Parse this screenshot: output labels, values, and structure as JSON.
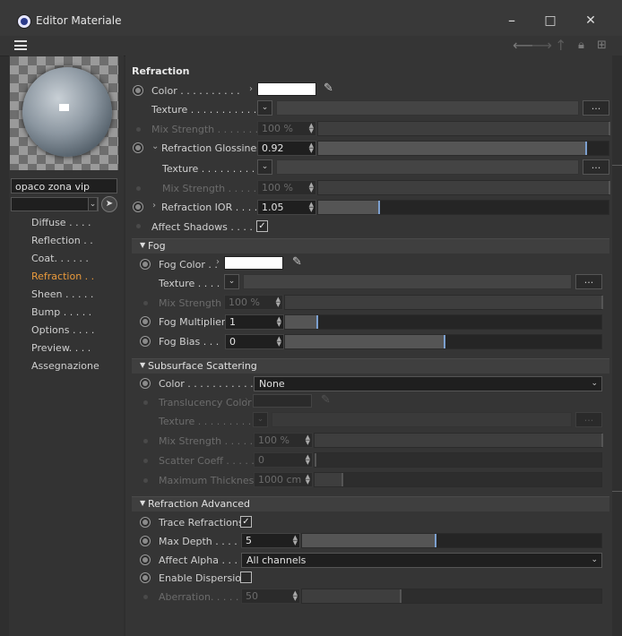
{
  "window": {
    "title": "Editor Materiale",
    "minimize": "–",
    "maximize": "□",
    "close": "✕"
  },
  "toolbar": {
    "back_icon": "arrow-left-icon",
    "forward_icon": "arrow-right-icon",
    "up_icon": "arrow-up-icon",
    "lock_icon": "lock-icon",
    "new_window_icon": "new-window-icon"
  },
  "left": {
    "material_name": "opaco zona vip",
    "nav": [
      {
        "label": "Diffuse . . . ."
      },
      {
        "label": "Reflection . ."
      },
      {
        "label": "Coat. . . . . ."
      },
      {
        "label": "Refraction . ."
      },
      {
        "label": "Sheen . . . . ."
      },
      {
        "label": "Bump . . . . ."
      },
      {
        "label": "Options . . . ."
      },
      {
        "label": "Preview. . . ."
      },
      {
        "label": "Assegnazione"
      }
    ],
    "active_index": 3
  },
  "refraction": {
    "header": "Refraction",
    "color_label": "Color . . . . . . . . . .",
    "texture_label": "Texture . . . . . . . . . . .",
    "texture_more": "...",
    "mix_strength_label": "Mix Strength . . . . . . .",
    "mix_strength_value": "100 %",
    "mix_strength_fraction": 1.0,
    "glossiness_label": "Refraction Glossiness",
    "glossiness_value": "0.92",
    "glossiness_fraction": 0.92,
    "gloss_texture_label": "Texture . . . . . . . . .",
    "gloss_mix_label": "Mix Strength . . . . .",
    "gloss_mix_value": "100 %",
    "ior_label": "Refraction IOR . . . .",
    "ior_value": "1.05",
    "ior_fraction": 0.21,
    "affect_shadows_label": "Affect Shadows . . . . .",
    "affect_shadows_checked": true
  },
  "fog": {
    "header": "Fog",
    "color_label": "Fog Color . .",
    "texture_label": "Texture . . . .",
    "mix_label": "Mix Strength . . . .",
    "mix_value": "100 %",
    "multiplier_label": "Fog Multiplier",
    "multiplier_value": "1",
    "multiplier_fraction": 0.1,
    "bias_label": "Fog Bias . . .",
    "bias_value": "0",
    "bias_fraction": 0.5
  },
  "sss": {
    "header": "Subsurface Scattering",
    "color_label": "Color . . . . . . . . . . .",
    "color_value": "None",
    "translucency_label": "Translucency Color",
    "texture_label": "Texture . . . . . . . . . .",
    "mix_label": "Mix Strength . . . . .",
    "mix_value": "100 %",
    "scatter_label": "Scatter Coeff . . . . . .",
    "scatter_value": "0",
    "thickness_label": "Maximum Thickness",
    "thickness_value": "1000 cm"
  },
  "advanced": {
    "header": "Refraction Advanced",
    "trace_label": "Trace Refractions",
    "trace_checked": true,
    "max_depth_label": "Max Depth . . . .",
    "max_depth_value": "5",
    "max_depth_fraction": 0.45,
    "affect_alpha_label": "Affect Alpha . . . .",
    "affect_alpha_value": "All channels",
    "dispersion_label": "Enable Dispersion",
    "dispersion_checked": false,
    "aberration_label": "Aberration. . . . .",
    "aberration_value": "50",
    "aberration_fraction": 0.33
  },
  "colors": {
    "accent": "#e99a3c",
    "slider_thumb": "#7ca0d0"
  }
}
